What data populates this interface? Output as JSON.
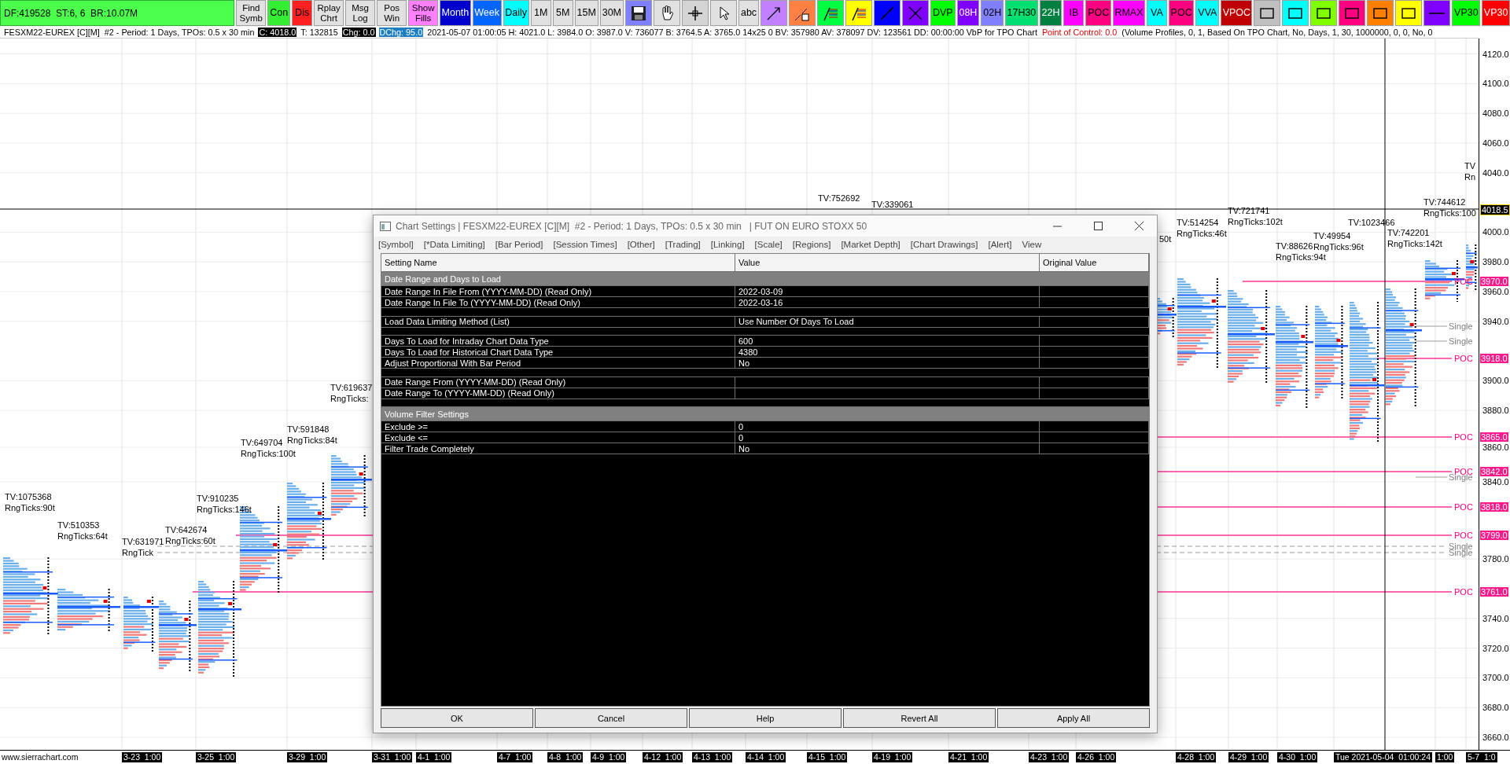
{
  "toolbar": {
    "status": "DF:419528  ST:6, 6  BR:10.07M",
    "buttons": [
      {
        "kind": "stacked",
        "label": "Find Symb",
        "color": "#e1e1e1"
      },
      {
        "kind": "text",
        "label": "Con",
        "color": "#33ee33"
      },
      {
        "kind": "text",
        "label": "Dis",
        "color": "#ff2020"
      },
      {
        "kind": "stacked",
        "label": "Rplay Chrt",
        "color": "#e1e1e1"
      },
      {
        "kind": "stacked",
        "label": "Msg Log",
        "color": "#e1e1e1"
      },
      {
        "kind": "stacked",
        "label": "Pos Win",
        "color": "#e1e1e1"
      },
      {
        "kind": "stacked",
        "label": "Show Fills",
        "color": "#ff80ff"
      },
      {
        "kind": "text",
        "label": "Month",
        "color": "#0000cc"
      },
      {
        "kind": "text",
        "label": "Week",
        "color": "#0066ff"
      },
      {
        "kind": "text",
        "label": "Daily",
        "color": "#00ffff"
      },
      {
        "kind": "text",
        "label": "1M",
        "color": "#e1e1e1"
      },
      {
        "kind": "text",
        "label": "5M",
        "color": "#e1e1e1"
      },
      {
        "kind": "text",
        "label": "15M",
        "color": "#e1e1e1"
      },
      {
        "kind": "text",
        "label": "30M",
        "color": "#e1e1e1"
      },
      {
        "kind": "save",
        "color": "#8080ff"
      },
      {
        "kind": "hand",
        "color": "#e1e1e1"
      },
      {
        "kind": "crosshair",
        "color": "#d4d4d4"
      },
      {
        "kind": "pointer",
        "color": "#e1e1e1"
      },
      {
        "kind": "text",
        "label": "abc",
        "color": "#e1e1e1"
      },
      {
        "kind": "arrow-line",
        "color": "#c080ff"
      },
      {
        "kind": "calc-line",
        "color": "#ff8040"
      },
      {
        "kind": "fib",
        "color": "#00ff40"
      },
      {
        "kind": "fib",
        "color": "#ffff00"
      },
      {
        "kind": "line",
        "color": "#0000ff"
      },
      {
        "kind": "cross-line",
        "color": "#8000ff"
      },
      {
        "kind": "text",
        "label": "DVP",
        "color": "#00ff00"
      },
      {
        "kind": "text",
        "label": "08H",
        "color": "#8000ff"
      },
      {
        "kind": "text",
        "label": "02H",
        "color": "#8080ff"
      },
      {
        "kind": "text",
        "label": "17H30",
        "color": "#00e070"
      },
      {
        "kind": "text",
        "label": "22H",
        "color": "#008040"
      },
      {
        "kind": "text",
        "label": "IB",
        "color": "#ff00ff"
      },
      {
        "kind": "text",
        "label": "POC",
        "color": "#ff0080"
      },
      {
        "kind": "text",
        "label": "RMAX",
        "color": "#ff00ff"
      },
      {
        "kind": "text",
        "label": "VA",
        "color": "#00ffff"
      },
      {
        "kind": "text",
        "label": "POC",
        "color": "#ff0080"
      },
      {
        "kind": "text",
        "label": "VVA",
        "color": "#00ffff"
      },
      {
        "kind": "text",
        "label": "VPOC",
        "color": "#c00000"
      },
      {
        "kind": "rect",
        "color": "#c0c0c0"
      },
      {
        "kind": "rect",
        "color": "#00ffff"
      },
      {
        "kind": "rect",
        "color": "#80ff00"
      },
      {
        "kind": "rect",
        "color": "#ff0080"
      },
      {
        "kind": "rect",
        "color": "#ff8000"
      },
      {
        "kind": "rect",
        "color": "#ffff00"
      },
      {
        "kind": "dash",
        "color": "#8000ff"
      },
      {
        "kind": "text",
        "label": "VP30",
        "color": "#00ff00"
      },
      {
        "kind": "text",
        "label": "VP30",
        "color": "#ff0000"
      }
    ]
  },
  "info_line": [
    {
      "kind": "plain",
      "text": "FESXM22-EUREX [C][M]  #2 - Period: 1 Days, TPOs: 0.5 x 30 min"
    },
    {
      "kind": "inverse",
      "text": "C: 4018.0"
    },
    {
      "kind": "plain",
      "text": "T: 132815"
    },
    {
      "kind": "inverse",
      "text": "Chg: 0.0"
    },
    {
      "kind": "highlight",
      "text": "DChg: 95.0"
    },
    {
      "kind": "plain",
      "text": "2021-05-07 01:00:05 H: 4021.0 L: 3984.0 O: 3987.0 V: 736077 B: 3764.5 A: 3765.0 14x25 0 BV: 357980 AV: 378097 DV: 123561 DD: 00:00:00 VbP for TPO Chart"
    },
    {
      "kind": "alert",
      "text": "Point of Control: 0.0"
    },
    {
      "kind": "plain",
      "text": "(Volume Profiles, 0, 1, Based On TPO Chart, No, Days, 1, 30, 1000000, 0, 0, No, 0"
    }
  ],
  "chart": {
    "labels": [
      "TV:1075368",
      "RngTicks:90t",
      "TV:510353",
      "RngTicks:64t",
      "TV:631971",
      "RngTick",
      "TV:642674",
      "RngTicks:60t",
      "TV:910235",
      "RngTicks:146t",
      "TV:649704",
      "RngTicks:100t",
      "TV:591848",
      "RngTicks:84t",
      "TV:619637",
      "RngTicks:",
      "TV:752692",
      "TV:339061",
      "50t",
      "TV:514254",
      "RngTicks:46t",
      "TV:721741",
      "RngTicks:102t",
      "TV:88626",
      "RngTicks:94t",
      "TV:49954",
      "RngTicks:96t",
      "TV:1023466",
      "TV:742201",
      "RngTicks:142t",
      "TV",
      "Rn",
      "TV:744612",
      "RngTicks:100"
    ],
    "single_labels": [
      "Single",
      "Single",
      "Single",
      "Single",
      "Single"
    ],
    "price_axis": {
      "ticks": [
        "4120.0",
        "4100.0",
        "4080.0",
        "4060.0",
        "4040.0",
        "4000.0",
        "3980.0",
        "3960.0",
        "3940.0",
        "3900.0",
        "3880.0",
        "3860.0",
        "3840.0",
        "3780.0",
        "3740.0",
        "3720.0",
        "3700.0",
        "3680.0",
        "3660.0"
      ],
      "markers": [
        {
          "kind": "current",
          "price": "4018.5"
        },
        {
          "kind": "poc",
          "price": "3970.0",
          "tag": "POC"
        },
        {
          "kind": "poc",
          "price": "3918.0",
          "tag": "POC"
        },
        {
          "kind": "poc",
          "price": "3865.0",
          "tag": "POC"
        },
        {
          "kind": "poc",
          "price": "3842.0",
          "tag": "POC"
        },
        {
          "kind": "poc",
          "price": "3818.0",
          "tag": "POC"
        },
        {
          "kind": "poc",
          "price": "3799.0",
          "tag": "POC"
        },
        {
          "kind": "poc",
          "price": "3761.0",
          "tag": "POC"
        }
      ]
    },
    "site": "www.sierrachart.com",
    "time_axis": [
      "3-23  1:00",
      "3-25  1:00",
      "3-29  1:00",
      "3-31  1:00",
      "4-1  1:00",
      "4-7  1:00",
      "4-8  1:00",
      "4-9  1:00",
      "4-12  1:00",
      "4-13  1:00",
      "4-14  1:00",
      "4-15  1:00",
      "4-19  1:00",
      "4-21  1:00",
      "4-23  1:00",
      "4-26  1:00",
      "4-28  1:00",
      "4-29  1:00",
      "4-30  1:00",
      "Tue 2021-05-04  01:00:24",
      "1:00",
      "5-7  1:0"
    ]
  },
  "dialog": {
    "title": "Chart Settings | FESXM22-EUREX [C][M]  #2 - Period: 1 Days, TPOs: 0.5 x 30 min   | FUT ON EURO STOXX 50",
    "tabs": [
      "[Symbol]",
      "[*Data Limiting]",
      "[Bar Period]",
      "[Session Times]",
      "[Other]",
      "[Trading]",
      "[Linking]",
      "[Scale]",
      "[Regions]",
      "[Market Depth]",
      "[Chart Drawings]",
      "[Alert]",
      "View"
    ],
    "columns": [
      "Setting Name",
      "Value",
      "Original Value"
    ],
    "rows": [
      {
        "kind": "section",
        "name": "Date Range and Days to Load"
      },
      {
        "kind": "setting",
        "name": "Date Range In File From (YYYY-MM-DD) (Read Only)",
        "value": "2022-03-09"
      },
      {
        "kind": "setting",
        "name": "Date Range In File To (YYYY-MM-DD) (Read Only)",
        "value": "2022-03-16"
      },
      {
        "kind": "blank"
      },
      {
        "kind": "setting",
        "name": "Load Data Limiting Method (List)",
        "value": "Use Number Of Days To Load"
      },
      {
        "kind": "blank"
      },
      {
        "kind": "setting",
        "name": "Days To Load for Intraday Chart Data Type",
        "value": "600"
      },
      {
        "kind": "setting",
        "name": "Days To Load for Historical Chart Data Type",
        "value": "4380"
      },
      {
        "kind": "setting",
        "name": "Adjust Proportional With Bar Period",
        "value": "No"
      },
      {
        "kind": "blank"
      },
      {
        "kind": "setting",
        "name": "Date Range From (YYYY-MM-DD) (Read Only)"
      },
      {
        "kind": "setting",
        "name": "Date Range To (YYYY-MM-DD) (Read Only)"
      },
      {
        "kind": "blank"
      },
      {
        "kind": "section",
        "name": "Volume Filter Settings"
      },
      {
        "kind": "setting",
        "name": "Exclude >=",
        "value": "0"
      },
      {
        "kind": "setting",
        "name": "Exclude <=",
        "value": "0"
      },
      {
        "kind": "setting",
        "name": "Filter Trade Completely",
        "value": "No"
      }
    ],
    "buttons": [
      "OK",
      "Cancel",
      "Help",
      "Revert All",
      "Apply All"
    ]
  }
}
